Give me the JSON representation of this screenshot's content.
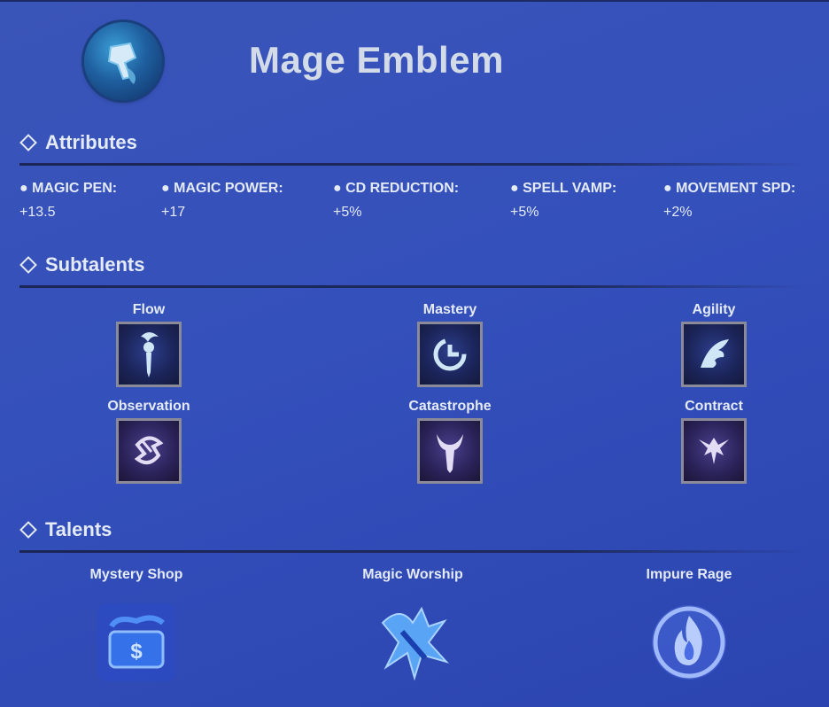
{
  "header": {
    "title": "Mage Emblem",
    "emblem_icon": "mage-emblem-icon"
  },
  "sections": {
    "attributes": "Attributes",
    "subtalents": "Subtalents",
    "talents": "Talents"
  },
  "attributes": [
    {
      "label": "● MAGIC PEN:",
      "value": "+13.5"
    },
    {
      "label": "● MAGIC POWER:",
      "value": "+17"
    },
    {
      "label": "● CD REDUCTION:",
      "value": "+5%"
    },
    {
      "label": "● SPELL VAMP:",
      "value": "+5%"
    },
    {
      "label": "● MOVEMENT SPD:",
      "value": "+2%"
    }
  ],
  "subtalents": [
    {
      "label": "Flow",
      "icon": "flow-icon"
    },
    {
      "label": "Mastery",
      "icon": "mastery-icon"
    },
    {
      "label": "Agility",
      "icon": "agility-icon"
    },
    {
      "label": "Observation",
      "icon": "observation-icon"
    },
    {
      "label": "Catastrophe",
      "icon": "catastrophe-icon"
    },
    {
      "label": "Contract",
      "icon": "contract-icon"
    }
  ],
  "talents": [
    {
      "label": "Mystery Shop",
      "icon": "mystery-shop-icon"
    },
    {
      "label": "Magic Worship",
      "icon": "magic-worship-icon"
    },
    {
      "label": "Impure Rage",
      "icon": "impure-rage-icon"
    }
  ],
  "colors": {
    "background": "#3450bb",
    "text": "#e4eaf6",
    "title": "#d3dbe8",
    "rule": "#1b2656"
  }
}
